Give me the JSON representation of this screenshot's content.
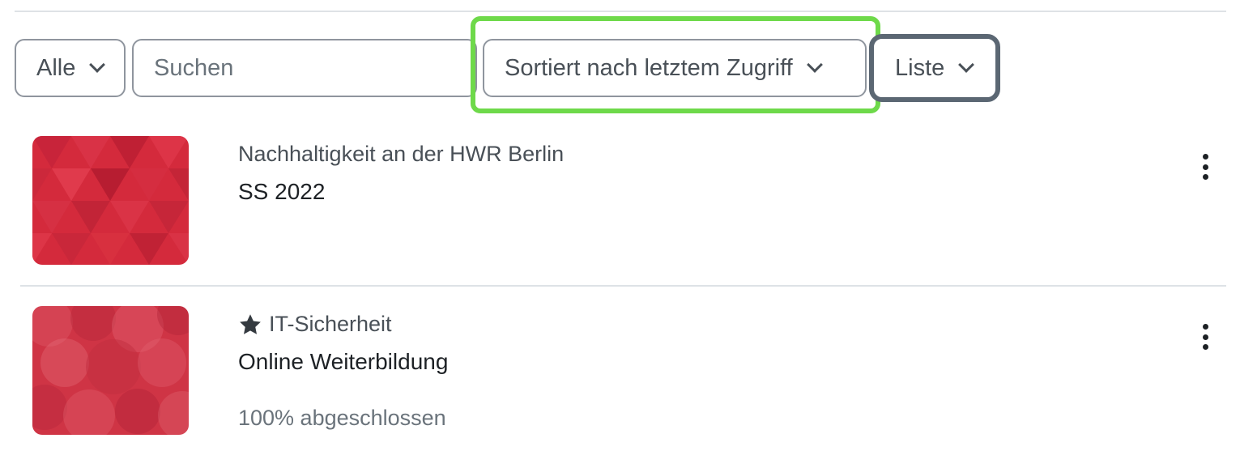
{
  "filters": {
    "grouping_label": "Alle",
    "search_placeholder": "Suchen",
    "sort_label": "Sortiert nach letztem Zugriff",
    "view_label": "Liste"
  },
  "highlight_color": "#6ed94a",
  "courses": [
    {
      "category": "Nachhaltigkeit an der HWR Berlin",
      "name": "SS 2022",
      "starred": false,
      "progress": null,
      "thumbnail_color": "#d42a3c",
      "actions_icon": "kebab-menu-icon"
    },
    {
      "category": "IT-Sicherheit",
      "name": "Online Weiterbildung",
      "starred": true,
      "progress": "100% abgeschlossen",
      "thumbnail_color": "#cf3445",
      "actions_icon": "kebab-menu-icon"
    }
  ]
}
